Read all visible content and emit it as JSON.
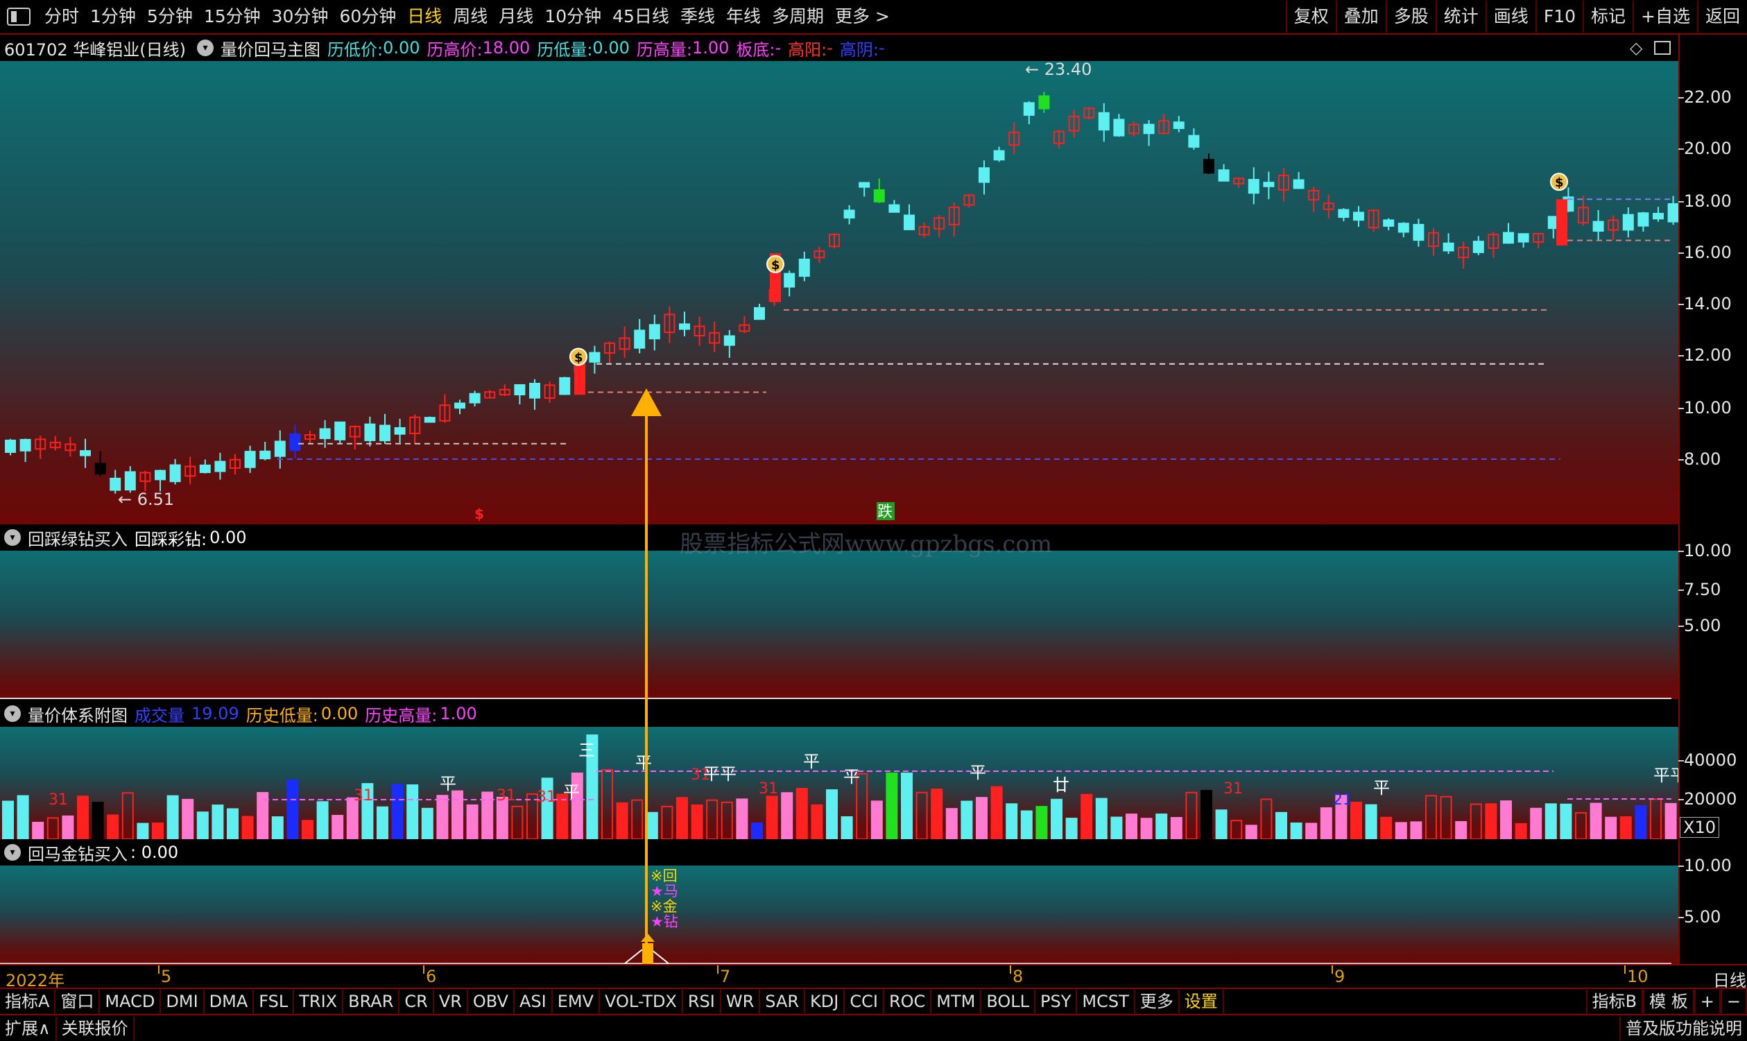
{
  "toolbar": {
    "periods": [
      "分时",
      "1分钟",
      "5分钟",
      "15分钟",
      "30分钟",
      "60分钟",
      "日线",
      "周线",
      "月线",
      "10分钟",
      "45日线",
      "季线",
      "年线",
      "多周期",
      "更多 >"
    ],
    "active_period": "日线",
    "right_buttons": [
      "复权",
      "叠加",
      "多股",
      "统计",
      "画线",
      "F10",
      "标记",
      "+自选",
      "返回"
    ]
  },
  "main_panel": {
    "stock": "601702 华峰铝业(日线)",
    "indicator": "量价回马主图",
    "hist_low_price_label": "历低价:",
    "hist_low_price": "0.00",
    "hist_high_price_label": "历高价:",
    "hist_high_price": "18.00",
    "hist_low_vol_label": "历低量:",
    "hist_low_vol": "0.00",
    "hist_high_vol_label": "历高量:",
    "hist_high_vol": "1.00",
    "board_bottom_label": "板底:",
    "board_bottom": "-",
    "high_yang_label": "高阳:",
    "high_yang": "-",
    "high_yin_label": "高阴:",
    "high_yin": "-",
    "max_label": "23.40",
    "min_label": "6.51",
    "scale": [
      "22.00",
      "20.00",
      "18.00",
      "16.00",
      "14.00",
      "12.00",
      "10.00",
      "8.00"
    ],
    "marker_dollar": "$",
    "marker_die": "跌"
  },
  "panel2": {
    "title": "回踩绿钻买入",
    "field_label": "回踩彩钻:",
    "field_value": "0.00",
    "scale": [
      "10.00",
      "7.50",
      "5.00"
    ],
    "watermark": "股票指标公式网www.gpzbgs.com"
  },
  "panel3": {
    "title": "量价体系附图",
    "vol_label": "成交量",
    "vol_value": "19.09",
    "low_label": "历史低量:",
    "low_value": "0.00",
    "high_label": "历史高量:",
    "high_value": "1.00",
    "scale": [
      "40000",
      "20000"
    ],
    "unit": "X10",
    "labels": {
      "ping": "平",
      "san": "三",
      "thirty_one": "31",
      "twenty_one": "21",
      "gan": "廿",
      "ping_ping": "平平"
    }
  },
  "panel4": {
    "title": "回马金钻买入",
    "field_value": ": 0.00",
    "scale": [
      "10.00",
      "5.00"
    ],
    "signal_lines": [
      "※回",
      "★马",
      "※金",
      "★钻"
    ]
  },
  "dates": {
    "year": "2022年",
    "months": [
      "5",
      "6",
      "7",
      "8",
      "9",
      "10"
    ],
    "period": "日线"
  },
  "indicator_tabs": [
    "指标A",
    "窗口",
    "MACD",
    "DMI",
    "DMA",
    "FSL",
    "TRIX",
    "BRAR",
    "CR",
    "VR",
    "OBV",
    "ASI",
    "EMV",
    "VOL-TDX",
    "RSI",
    "WR",
    "SAR",
    "KDJ",
    "CCI",
    "ROC",
    "MTM",
    "BOLL",
    "PSY",
    "MCST",
    "更多",
    "设置"
  ],
  "indicator_right": [
    "指标B",
    "模 板",
    "+",
    "−"
  ],
  "status": {
    "expand": "扩展∧",
    "quote": "关联报价",
    "help": "普及版功能说明"
  },
  "colors": {
    "up": "#ff2020",
    "down": "#5ef0f0",
    "pink": "#ff7ad0",
    "blue": "#1a2cff",
    "green": "#20e020",
    "arrow": "#ffb000",
    "magenta_text": "#ff40ff",
    "cyan_text": "#40e0e0",
    "yellow_text": "#ffd700"
  }
}
